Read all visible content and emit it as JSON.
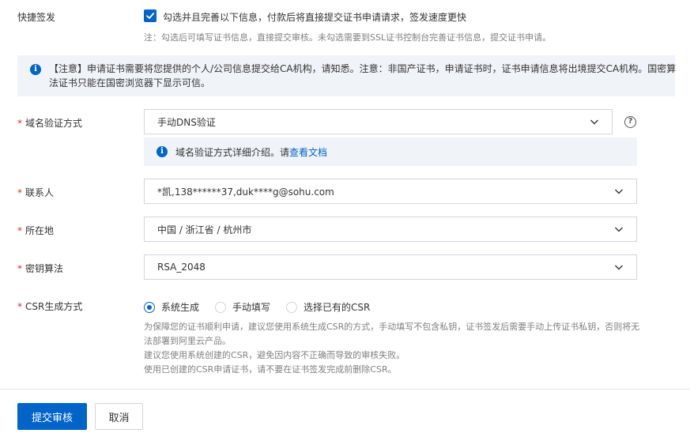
{
  "quick_sign": {
    "label": "快捷签发",
    "checkbox_text": "勾选并且完善以下信息，付款后将直接提交证书申请请求，签发速度更快",
    "checked": true,
    "note": "注：勾选后可填写证书信息，直接提交审核。未勾选需要到SSL证书控制台完善证书信息，提交证书申请。"
  },
  "notice": {
    "text": "【注意】申请证书需要将您提供的个人/公司信息提交给CA机构，请知悉。注意：非国产证书，申请证书时，证书申请信息将出境提交CA机构。国密算法证书只能在国密浏览器下显示可信。"
  },
  "fields": {
    "required_mark": "*",
    "domain_verify": {
      "label": "域名验证方式",
      "value": "手动DNS验证",
      "help": "?",
      "tip_prefix": "域名验证方式详细介绍。请",
      "tip_link": "查看文档"
    },
    "contact": {
      "label": "联系人",
      "value": "*凯,138******37,duk****g@sohu.com"
    },
    "location": {
      "label": "所在地",
      "value": "中国 / 浙江省 / 杭州市"
    },
    "key_algo": {
      "label": "密钥算法",
      "value": "RSA_2048"
    },
    "csr": {
      "label": "CSR生成方式",
      "options": [
        "系统生成",
        "手动填写",
        "选择已有的CSR"
      ],
      "selected": "系统生成",
      "desc1": "为保障您的证书顺利申请，建议您使用系统生成CSR的方式，手动填写不包含私钥，证书签发后需要手动上传证书私钥，否则将无法部署到阿里云产品。",
      "desc2": "建议您使用系统创建的CSR，避免因内容不正确而导致的审核失败。",
      "desc3": "使用已创建的CSR申请证书，请不要在证书签发完成前删除CSR。"
    }
  },
  "actions": {
    "submit": "提交审核",
    "cancel": "取消"
  },
  "icons": {
    "info": "info-icon",
    "help": "question-circle-icon",
    "chevron": "chevron-down-icon",
    "check": "check-icon"
  },
  "colors": {
    "primary": "#0064c8",
    "required": "#d93026",
    "notice_bg": "#f0f3f8"
  }
}
